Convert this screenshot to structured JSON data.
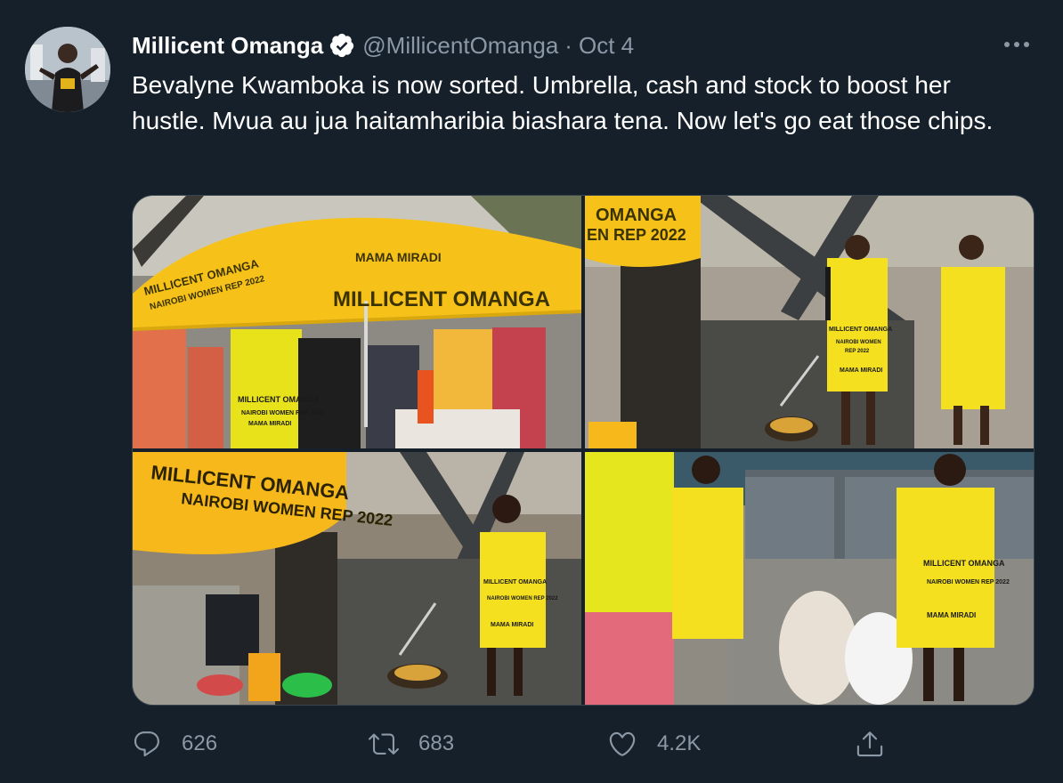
{
  "tweet": {
    "author": {
      "display_name": "Millicent Omanga",
      "handle": "@MillicentOmanga",
      "verified": true
    },
    "separator": "·",
    "date": "Oct 4",
    "text": "Bevalyne Kwamboka is now sorted. Umbrella, cash and stock to boost her hustle. Mvua au jua haitamharibia biashara tena. Now let's go eat those chips.",
    "media": [
      {
        "description": "photo-1",
        "visible_text": [
          "MAMA MIRADI",
          "MILLICENT OMANGA",
          "MILLICENT OMANGA",
          "NAIROBI WOMEN REP 2022",
          "MILLICENT OMANGA",
          "NAIROBI WOMEN REP 2022",
          "MAMA MIRADI"
        ]
      },
      {
        "description": "photo-2",
        "visible_text": [
          "OMANGA",
          "EN REP 2022",
          "MILLICENT OMANGA",
          "NAIROBI WOMEN REP 2022",
          "MAMA MIRADI"
        ]
      },
      {
        "description": "photo-3",
        "visible_text": [
          "MILLICENT OMANGA",
          "NAIROBI WOMEN REP 2022",
          "MILLICENT OMANGA",
          "NAIROBI WOMEN REP 2022",
          "MAMA MIRADI"
        ]
      },
      {
        "description": "photo-4",
        "visible_text": [
          "MILLICENT OMANGA",
          "NAIROBI WOMEN REP 2022",
          "MAMA MIRADI"
        ]
      }
    ],
    "actions": {
      "reply_count": "626",
      "retweet_count": "683",
      "like_count": "4.2K"
    },
    "icons": {
      "reply": "reply-icon",
      "retweet": "retweet-icon",
      "like": "heart-icon",
      "share": "share-icon",
      "more": "more-icon",
      "verified": "verified-badge-icon"
    },
    "colors": {
      "background": "#15202b",
      "text_primary": "#ffffff",
      "text_secondary": "#8b98a5",
      "verified_badge": "#ffffff",
      "border": "#38444d",
      "umbrella_yellow": "#f6c21a",
      "apron_yellow": "#f4e01f"
    }
  }
}
